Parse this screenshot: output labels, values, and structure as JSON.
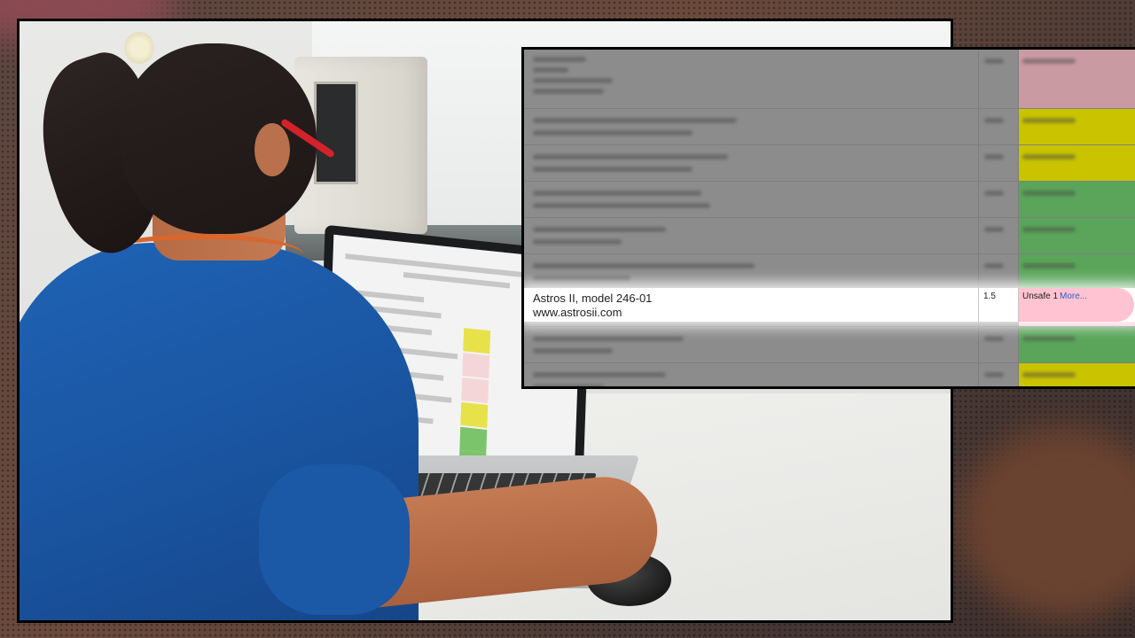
{
  "colors": {
    "scrub_blue": "#1a55a1",
    "collar_orange": "#d9662d",
    "glasses_red": "#d4222a",
    "status_pink": "#ffc3d1",
    "status_yellow": "#c9c300",
    "status_green": "#5aa55a",
    "status_rose": "#c99aa2",
    "link_blue": "#2a5fc7"
  },
  "inset": {
    "row_statuses": [
      "rose",
      "yellow",
      "yellow",
      "green",
      "green",
      "green",
      "pink",
      "green",
      "yellow"
    ],
    "highlight": {
      "device_name": "Astros II, model 246-01",
      "device_url": "www.astrosii.com",
      "rating": "1.5",
      "status": "Unsafe 1",
      "more_link": "More..."
    }
  }
}
